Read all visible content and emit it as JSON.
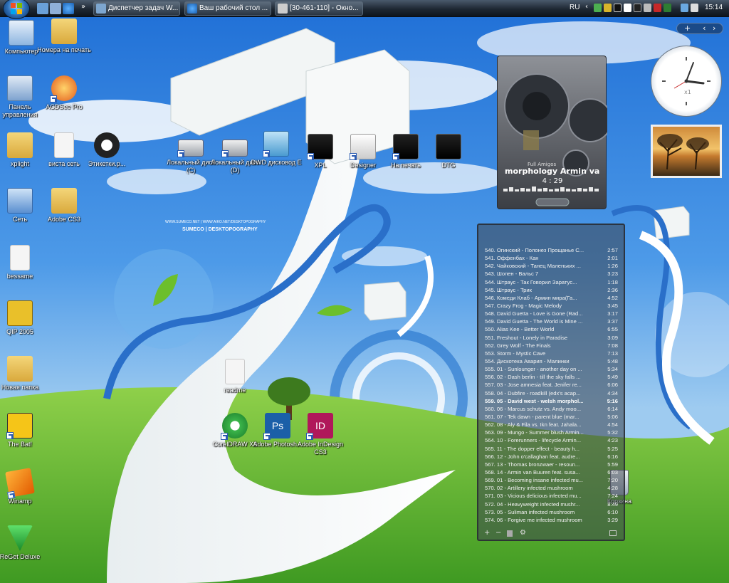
{
  "taskbar": {
    "tasks": [
      {
        "label": "Диспетчер задач W..."
      },
      {
        "label": "Ваш рабочий стол ..."
      },
      {
        "label": "[30-461-110] - Окно..."
      }
    ],
    "language": "RU",
    "time": "15:14"
  },
  "desktop_icons": [
    {
      "label": "Компьютер"
    },
    {
      "label": "Номера на печать"
    },
    {
      "label": "Панель управления"
    },
    {
      "label": "ACDSee Pro"
    },
    {
      "label": "xplight"
    },
    {
      "label": "виста сеть"
    },
    {
      "label": "Этикетки.р..."
    },
    {
      "label": "Сеть"
    },
    {
      "label": "Adobe CS3"
    },
    {
      "label": "bessame"
    },
    {
      "label": "QIP 2005"
    },
    {
      "label": "Новая папка"
    },
    {
      "label": "The Bat!"
    },
    {
      "label": "Winamp"
    },
    {
      "label": "ReGet Deluxe"
    },
    {
      "label": "Локальный диск (C)"
    },
    {
      "label": "Локальный диск (D)"
    },
    {
      "label": "DWD дисковод E"
    },
    {
      "label": "XPL"
    },
    {
      "label": "Designer"
    },
    {
      "label": "На печать"
    },
    {
      "label": "DTG"
    },
    {
      "label": "readme"
    },
    {
      "label": "CorelDRAW X3"
    },
    {
      "label": "Adobe Photosh..."
    },
    {
      "label": "Adobe InDesign CS3"
    },
    {
      "label": "Корзина"
    }
  ],
  "app_icon_letters": {
    "ps": "Ps",
    "id": "ID"
  },
  "wallpaper": {
    "url": "WWW.SUMECO.NET | WWW.AIKO.NET/DESKTOPOGRAPHY",
    "brand": "SUMECO | DESKTOPOGRAPHY"
  },
  "sidebar": {
    "controls": "+"
  },
  "photo_gadget": {},
  "clock_gadget": {
    "label": "x1"
  },
  "player": {
    "track_title": "morphology Armin va",
    "time": "4 : 29",
    "overlay_label": "Full Amigos"
  },
  "playlist": {
    "rows": [
      {
        "text": "540. Огинский - Полонез Прощанье С...",
        "dur": "2:57"
      },
      {
        "text": "541. Оффенбах - Кан",
        "dur": "2:01"
      },
      {
        "text": "542. Чайковский - Танец Маленьких ...",
        "dur": "1:26"
      },
      {
        "text": "543. Шопен - Вальс 7",
        "dur": "3:23"
      },
      {
        "text": "544. Штраус - Так Говорил Заратус...",
        "dur": "1:18"
      },
      {
        "text": "545. Штраус - Трик",
        "dur": "2:36"
      },
      {
        "text": "546. Комеди Клаб - Армин мира(Га...",
        "dur": "4:52"
      },
      {
        "text": "547. Crazy Frog - Magic Melody",
        "dur": "3:45"
      },
      {
        "text": "548. David Guetta - Love is Gone (Rad...",
        "dur": "3:17"
      },
      {
        "text": "549. David Guetta - The World is Mine ...",
        "dur": "3:37"
      },
      {
        "text": "550. Alias Kee - Better World",
        "dur": "6:55"
      },
      {
        "text": "551. Freshout - Lonely in Paradise",
        "dur": "3:09"
      },
      {
        "text": "552. Grey Wolf - The Finals",
        "dur": "7:08"
      },
      {
        "text": "553. Storm - Mystic Cave",
        "dur": "7:13"
      },
      {
        "text": "554. Дискотека Авария - Малинки",
        "dur": "5:48"
      },
      {
        "text": "555. 01 - Sunlounger - another day on ...",
        "dur": "5:34"
      },
      {
        "text": "556. 02 - Dash berlin - till the sky falls ...",
        "dur": "5:49"
      },
      {
        "text": "557. 03 - Jose amnesia feat. Jenifer re...",
        "dur": "6:06"
      },
      {
        "text": "558. 04 - Dubfire - roadkill (edx's acap...",
        "dur": "4:34"
      },
      {
        "text": "559. 05 - David west - welsh morphol...",
        "dur": "5:16"
      },
      {
        "text": "560. 06 - Marcus schutz vs. Andy moo...",
        "dur": "6:14"
      },
      {
        "text": "561. 07 - Tek dawn - parent blue (mar...",
        "dur": "5:06"
      },
      {
        "text": "562. 08 - Aly & Fila vs. Ikn feat. Jahala...",
        "dur": "4:54"
      },
      {
        "text": "563. 09 - Mungo - Summer blush Armin...",
        "dur": "5:32"
      },
      {
        "text": "564. 10 - Forerunners - lifecycle Armin...",
        "dur": "4:23"
      },
      {
        "text": "565. 11 - The dopper effect - beauty h...",
        "dur": "5:25"
      },
      {
        "text": "566. 12 - John o'callaghan feat. audre...",
        "dur": "6:16"
      },
      {
        "text": "567. 13 - Thomas bronzwaer - resoun...",
        "dur": "5:59"
      },
      {
        "text": "568. 14 - Armin van Buuren feat. susa...",
        "dur": "6:03"
      },
      {
        "text": "569. 01 - Becoming insane infected mu...",
        "dur": "7:20"
      },
      {
        "text": "570. 02 - Artillery infected mushroom",
        "dur": "4:28"
      },
      {
        "text": "571. 03 - Vicious delicious infected mu...",
        "dur": "7:24"
      },
      {
        "text": "572. 04 - Heavyweight infected mushr...",
        "dur": "8:49"
      },
      {
        "text": "573. 05 - Suliman infected mushroom",
        "dur": "6:10"
      },
      {
        "text": "574. 06 - Forgive me infected mushroom",
        "dur": "3:29"
      }
    ],
    "current_index": 19
  },
  "colors": {
    "accent": "#2a6fc9",
    "grass": "#5fb534",
    "sky": "#3f8fe0"
  }
}
